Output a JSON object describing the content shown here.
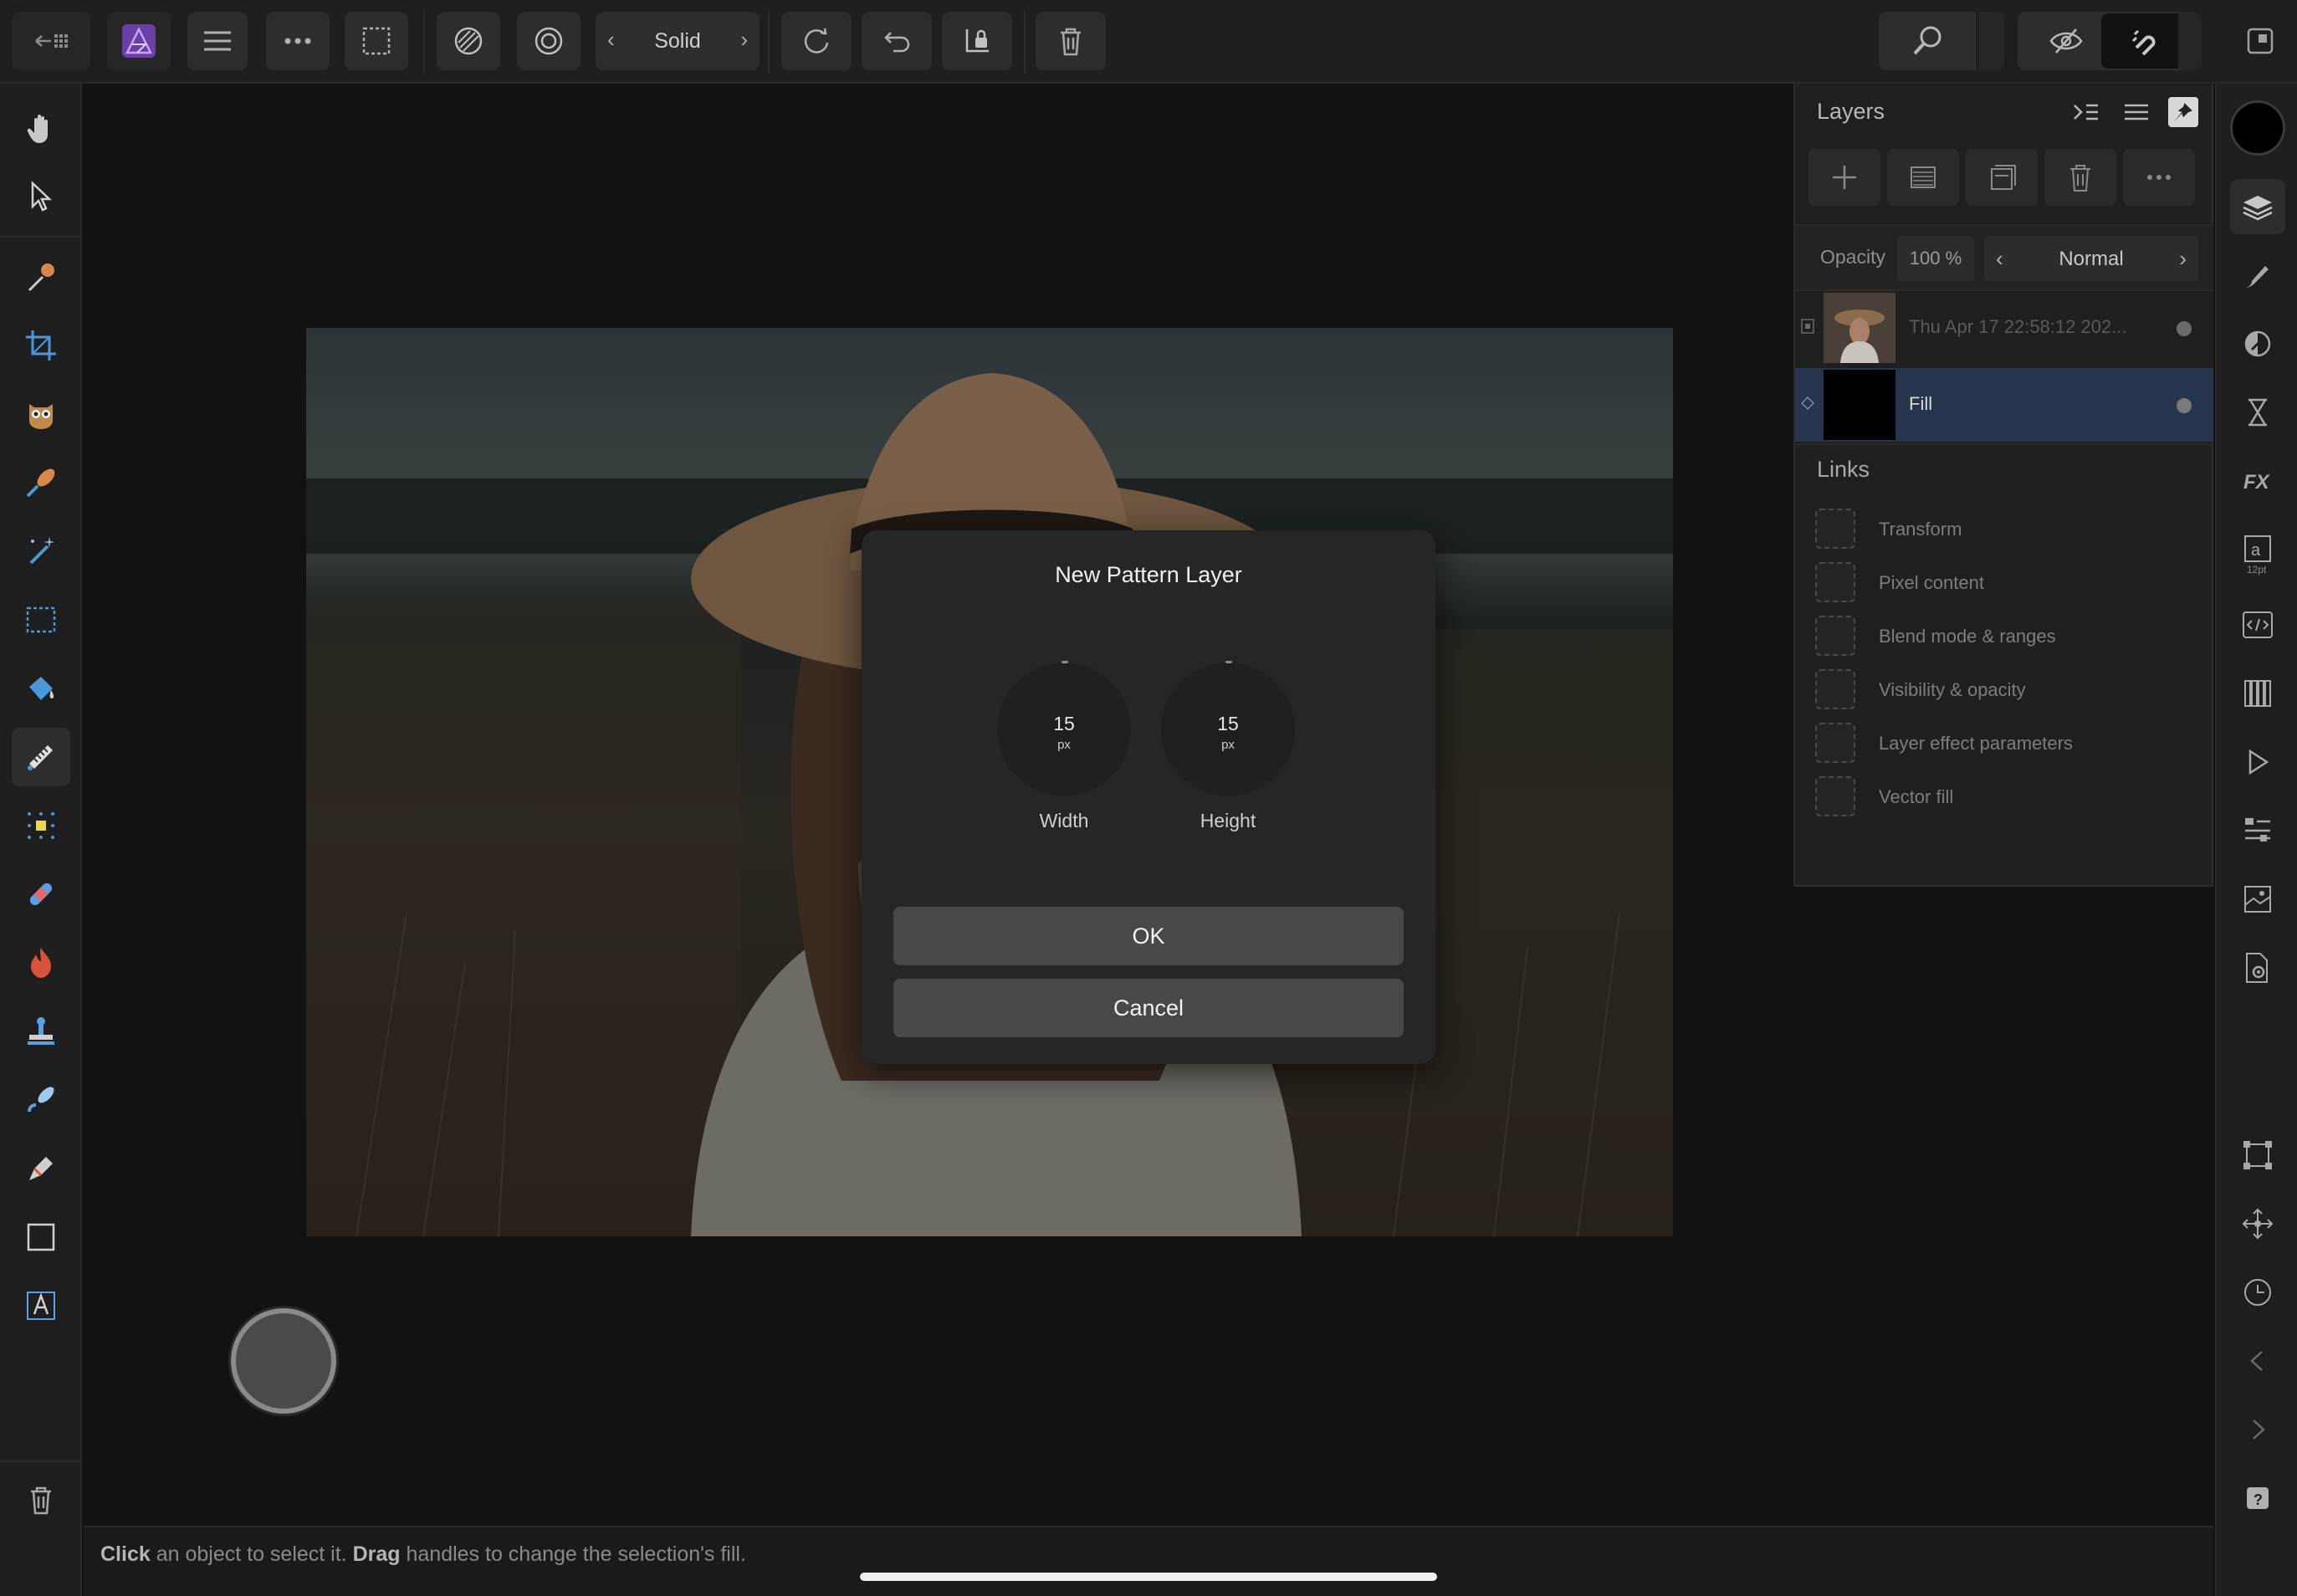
{
  "toolbar": {
    "mode": "Solid",
    "buttons": [
      "back-to-gallery",
      "app-menu",
      "hamburger-menu",
      "more-options",
      "selection-marquee",
      "fill-mode",
      "stroke-mode",
      "mode-prev",
      "mode-next",
      "reset",
      "undo",
      "lock",
      "delete",
      "zoom",
      "assistant-view",
      "snapping",
      "fullscreen"
    ]
  },
  "left_tools": [
    "hand-tool",
    "move-tool",
    "color-picker-tool",
    "crop-tool",
    "red-eye-tool",
    "brush-tool",
    "magic-wand-tool",
    "marquee-tool",
    "flood-fill-tool",
    "gradient-tool",
    "dodge-tool",
    "healing-tool",
    "burn-tool",
    "clone-tool",
    "paint-mixer-tool",
    "pen-tool",
    "rectangle-tool",
    "text-tool",
    "delete-tool"
  ],
  "right_strip": {
    "text_size_hint": "12pt",
    "icons": [
      "layers",
      "brushes",
      "adjustments",
      "history-hourglass",
      "effects",
      "text-styles",
      "macros",
      "channels",
      "stock",
      "navigator",
      "swatches",
      "settings",
      "transform",
      "move",
      "history-clock",
      "chevron-left",
      "chevron-right",
      "help"
    ]
  },
  "layers_panel": {
    "title": "Layers",
    "opacity_label": "Opacity",
    "opacity_value": "100 %",
    "blend_mode": "Normal",
    "layers": [
      {
        "name": "Thu Apr 17 22:58:12 202...",
        "selected": false
      },
      {
        "name": "Fill",
        "selected": true
      }
    ],
    "links_title": "Links",
    "links": [
      "Transform",
      "Pixel content",
      "Blend mode & ranges",
      "Visibility & opacity",
      "Layer effect parameters",
      "Vector fill"
    ]
  },
  "dialog": {
    "title": "New Pattern Layer",
    "width": {
      "value": "15",
      "unit": "px",
      "label": "Width"
    },
    "height": {
      "value": "15",
      "unit": "px",
      "label": "Height"
    },
    "ok_label": "OK",
    "cancel_label": "Cancel"
  },
  "status": {
    "click_word": "Click",
    "click_text": " an object to select it. ",
    "drag_word": "Drag",
    "drag_text": " handles to change the selection's fill."
  },
  "colors": {
    "accent": "#7a4fc0",
    "selected_layer": "#26354d",
    "primary_color": "#000000"
  }
}
